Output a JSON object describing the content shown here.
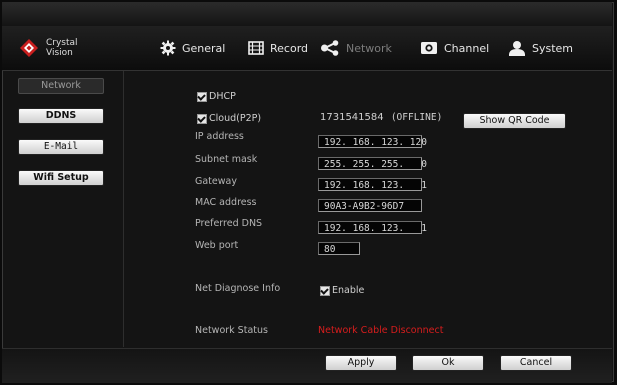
{
  "brand": {
    "line1": "Crystal",
    "line2": "Vision"
  },
  "nav": [
    {
      "label": "General",
      "icon": "gear-icon",
      "active": false
    },
    {
      "label": "Record",
      "icon": "film-icon",
      "active": false
    },
    {
      "label": "Network",
      "icon": "share-icon",
      "active": true
    },
    {
      "label": "Channel",
      "icon": "camera-icon",
      "active": false
    },
    {
      "label": "System",
      "icon": "user-icon",
      "active": false
    }
  ],
  "sidebar": {
    "items": [
      {
        "label": "Network",
        "active": true
      },
      {
        "label": "DDNS",
        "active": false
      },
      {
        "label": "E-Mail",
        "active": false
      },
      {
        "label": "Wifi Setup",
        "active": false
      }
    ]
  },
  "form": {
    "dhcp_label": "DHCP",
    "cloud_label": "Cloud(P2P)",
    "cloud_id": "1731541584",
    "cloud_status": "(OFFLINE)",
    "qr_button": "Show QR Code",
    "ip_label": "IP address",
    "ip_value": "192. 168. 123. 120",
    "subnet_label": "Subnet mask",
    "subnet_value": "255. 255. 255.   0",
    "gateway_label": "Gateway",
    "gateway_value": "192. 168. 123.   1",
    "mac_label": "MAC address",
    "mac_value": "90A3-A9B2-96D7",
    "dns_label": "Preferred DNS",
    "dns_value": "192. 168. 123.   1",
    "port_label": "Web port",
    "port_value": "80",
    "diag_label": "Net Diagnose Info",
    "diag_enable": "Enable",
    "status_label": "Network Status",
    "status_value": "Network Cable Disconnect"
  },
  "footer": {
    "apply": "Apply",
    "ok": "Ok",
    "cancel": "Cancel"
  },
  "colors": {
    "status_error": "#d61d1d",
    "logo_red": "#c81e1e",
    "active_nav": "#7c7c7c"
  }
}
